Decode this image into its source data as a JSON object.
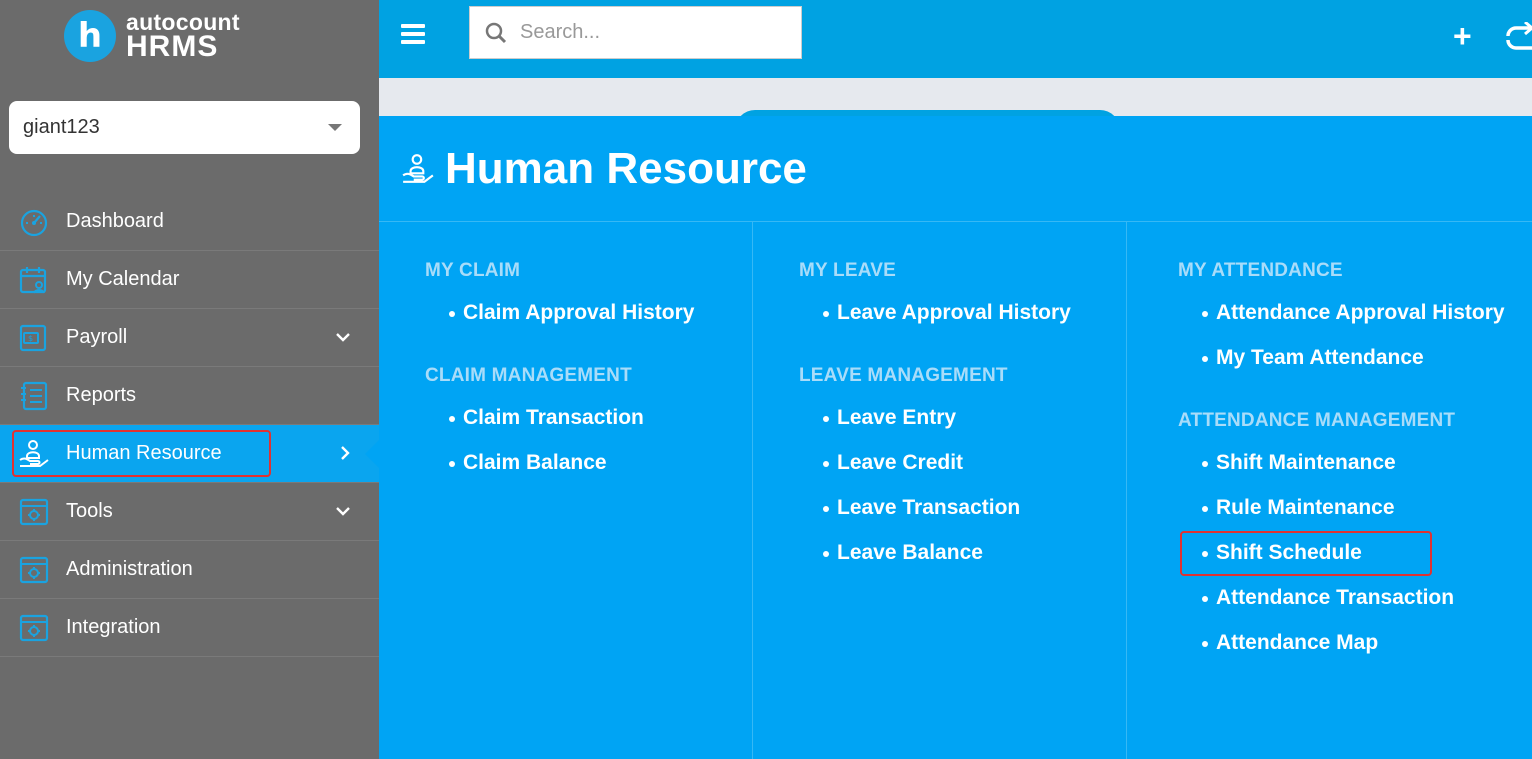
{
  "brand": {
    "line1": "autocount",
    "line2": "HRMS",
    "logo_letter": "h"
  },
  "company_select": {
    "value": "giant123"
  },
  "sidebar": {
    "items": [
      {
        "label": "Dashboard",
        "icon": "dashboard-icon",
        "chevron": ""
      },
      {
        "label": "My Calendar",
        "icon": "calendar-icon",
        "chevron": ""
      },
      {
        "label": "Payroll",
        "icon": "payroll-icon",
        "chevron": "down"
      },
      {
        "label": "Reports",
        "icon": "reports-icon",
        "chevron": ""
      },
      {
        "label": "Human Resource",
        "icon": "human-resource-icon",
        "chevron": "right",
        "active": true
      },
      {
        "label": "Tools",
        "icon": "tools-icon",
        "chevron": "down"
      },
      {
        "label": "Administration",
        "icon": "administration-icon",
        "chevron": ""
      },
      {
        "label": "Integration",
        "icon": "integration-icon",
        "chevron": ""
      }
    ]
  },
  "topbar": {
    "search_placeholder": "Search...",
    "plus_label": "+"
  },
  "mega_menu": {
    "title": "Human Resource",
    "columns": [
      {
        "sections": [
          {
            "title": "MY CLAIM",
            "items": [
              "Claim Approval History"
            ]
          },
          {
            "title": "CLAIM MANAGEMENT",
            "items": [
              "Claim Transaction",
              "Claim Balance"
            ]
          }
        ]
      },
      {
        "sections": [
          {
            "title": "MY LEAVE",
            "items": [
              "Leave Approval History"
            ]
          },
          {
            "title": "LEAVE MANAGEMENT",
            "items": [
              "Leave Entry",
              "Leave Credit",
              "Leave Transaction",
              "Leave Balance"
            ]
          }
        ]
      },
      {
        "sections": [
          {
            "title": "MY ATTENDANCE",
            "items": [
              "Attendance Approval History",
              "My Team Attendance"
            ]
          },
          {
            "title": "ATTENDANCE MANAGEMENT",
            "items": [
              "Shift Maintenance",
              "Rule Maintenance",
              "Shift Schedule",
              "Attendance Transaction",
              "Attendance Map"
            ]
          }
        ]
      }
    ]
  },
  "colors": {
    "sidebar_bg": "#6b6b6b",
    "accent": "#00a4f4",
    "topbar": "#00a2e2",
    "highlight": "#e03232"
  }
}
